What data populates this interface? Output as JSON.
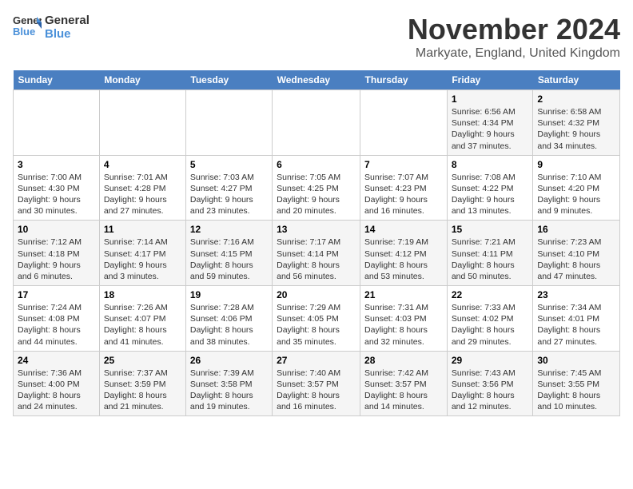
{
  "logo": {
    "line1": "General",
    "line2": "Blue"
  },
  "title": "November 2024",
  "location": "Markyate, England, United Kingdom",
  "days_of_week": [
    "Sunday",
    "Monday",
    "Tuesday",
    "Wednesday",
    "Thursday",
    "Friday",
    "Saturday"
  ],
  "weeks": [
    [
      {
        "day": "",
        "info": ""
      },
      {
        "day": "",
        "info": ""
      },
      {
        "day": "",
        "info": ""
      },
      {
        "day": "",
        "info": ""
      },
      {
        "day": "",
        "info": ""
      },
      {
        "day": "1",
        "info": "Sunrise: 6:56 AM\nSunset: 4:34 PM\nDaylight: 9 hours and 37 minutes."
      },
      {
        "day": "2",
        "info": "Sunrise: 6:58 AM\nSunset: 4:32 PM\nDaylight: 9 hours and 34 minutes."
      }
    ],
    [
      {
        "day": "3",
        "info": "Sunrise: 7:00 AM\nSunset: 4:30 PM\nDaylight: 9 hours and 30 minutes."
      },
      {
        "day": "4",
        "info": "Sunrise: 7:01 AM\nSunset: 4:28 PM\nDaylight: 9 hours and 27 minutes."
      },
      {
        "day": "5",
        "info": "Sunrise: 7:03 AM\nSunset: 4:27 PM\nDaylight: 9 hours and 23 minutes."
      },
      {
        "day": "6",
        "info": "Sunrise: 7:05 AM\nSunset: 4:25 PM\nDaylight: 9 hours and 20 minutes."
      },
      {
        "day": "7",
        "info": "Sunrise: 7:07 AM\nSunset: 4:23 PM\nDaylight: 9 hours and 16 minutes."
      },
      {
        "day": "8",
        "info": "Sunrise: 7:08 AM\nSunset: 4:22 PM\nDaylight: 9 hours and 13 minutes."
      },
      {
        "day": "9",
        "info": "Sunrise: 7:10 AM\nSunset: 4:20 PM\nDaylight: 9 hours and 9 minutes."
      }
    ],
    [
      {
        "day": "10",
        "info": "Sunrise: 7:12 AM\nSunset: 4:18 PM\nDaylight: 9 hours and 6 minutes."
      },
      {
        "day": "11",
        "info": "Sunrise: 7:14 AM\nSunset: 4:17 PM\nDaylight: 9 hours and 3 minutes."
      },
      {
        "day": "12",
        "info": "Sunrise: 7:16 AM\nSunset: 4:15 PM\nDaylight: 8 hours and 59 minutes."
      },
      {
        "day": "13",
        "info": "Sunrise: 7:17 AM\nSunset: 4:14 PM\nDaylight: 8 hours and 56 minutes."
      },
      {
        "day": "14",
        "info": "Sunrise: 7:19 AM\nSunset: 4:12 PM\nDaylight: 8 hours and 53 minutes."
      },
      {
        "day": "15",
        "info": "Sunrise: 7:21 AM\nSunset: 4:11 PM\nDaylight: 8 hours and 50 minutes."
      },
      {
        "day": "16",
        "info": "Sunrise: 7:23 AM\nSunset: 4:10 PM\nDaylight: 8 hours and 47 minutes."
      }
    ],
    [
      {
        "day": "17",
        "info": "Sunrise: 7:24 AM\nSunset: 4:08 PM\nDaylight: 8 hours and 44 minutes."
      },
      {
        "day": "18",
        "info": "Sunrise: 7:26 AM\nSunset: 4:07 PM\nDaylight: 8 hours and 41 minutes."
      },
      {
        "day": "19",
        "info": "Sunrise: 7:28 AM\nSunset: 4:06 PM\nDaylight: 8 hours and 38 minutes."
      },
      {
        "day": "20",
        "info": "Sunrise: 7:29 AM\nSunset: 4:05 PM\nDaylight: 8 hours and 35 minutes."
      },
      {
        "day": "21",
        "info": "Sunrise: 7:31 AM\nSunset: 4:03 PM\nDaylight: 8 hours and 32 minutes."
      },
      {
        "day": "22",
        "info": "Sunrise: 7:33 AM\nSunset: 4:02 PM\nDaylight: 8 hours and 29 minutes."
      },
      {
        "day": "23",
        "info": "Sunrise: 7:34 AM\nSunset: 4:01 PM\nDaylight: 8 hours and 27 minutes."
      }
    ],
    [
      {
        "day": "24",
        "info": "Sunrise: 7:36 AM\nSunset: 4:00 PM\nDaylight: 8 hours and 24 minutes."
      },
      {
        "day": "25",
        "info": "Sunrise: 7:37 AM\nSunset: 3:59 PM\nDaylight: 8 hours and 21 minutes."
      },
      {
        "day": "26",
        "info": "Sunrise: 7:39 AM\nSunset: 3:58 PM\nDaylight: 8 hours and 19 minutes."
      },
      {
        "day": "27",
        "info": "Sunrise: 7:40 AM\nSunset: 3:57 PM\nDaylight: 8 hours and 16 minutes."
      },
      {
        "day": "28",
        "info": "Sunrise: 7:42 AM\nSunset: 3:57 PM\nDaylight: 8 hours and 14 minutes."
      },
      {
        "day": "29",
        "info": "Sunrise: 7:43 AM\nSunset: 3:56 PM\nDaylight: 8 hours and 12 minutes."
      },
      {
        "day": "30",
        "info": "Sunrise: 7:45 AM\nSunset: 3:55 PM\nDaylight: 8 hours and 10 minutes."
      }
    ]
  ]
}
